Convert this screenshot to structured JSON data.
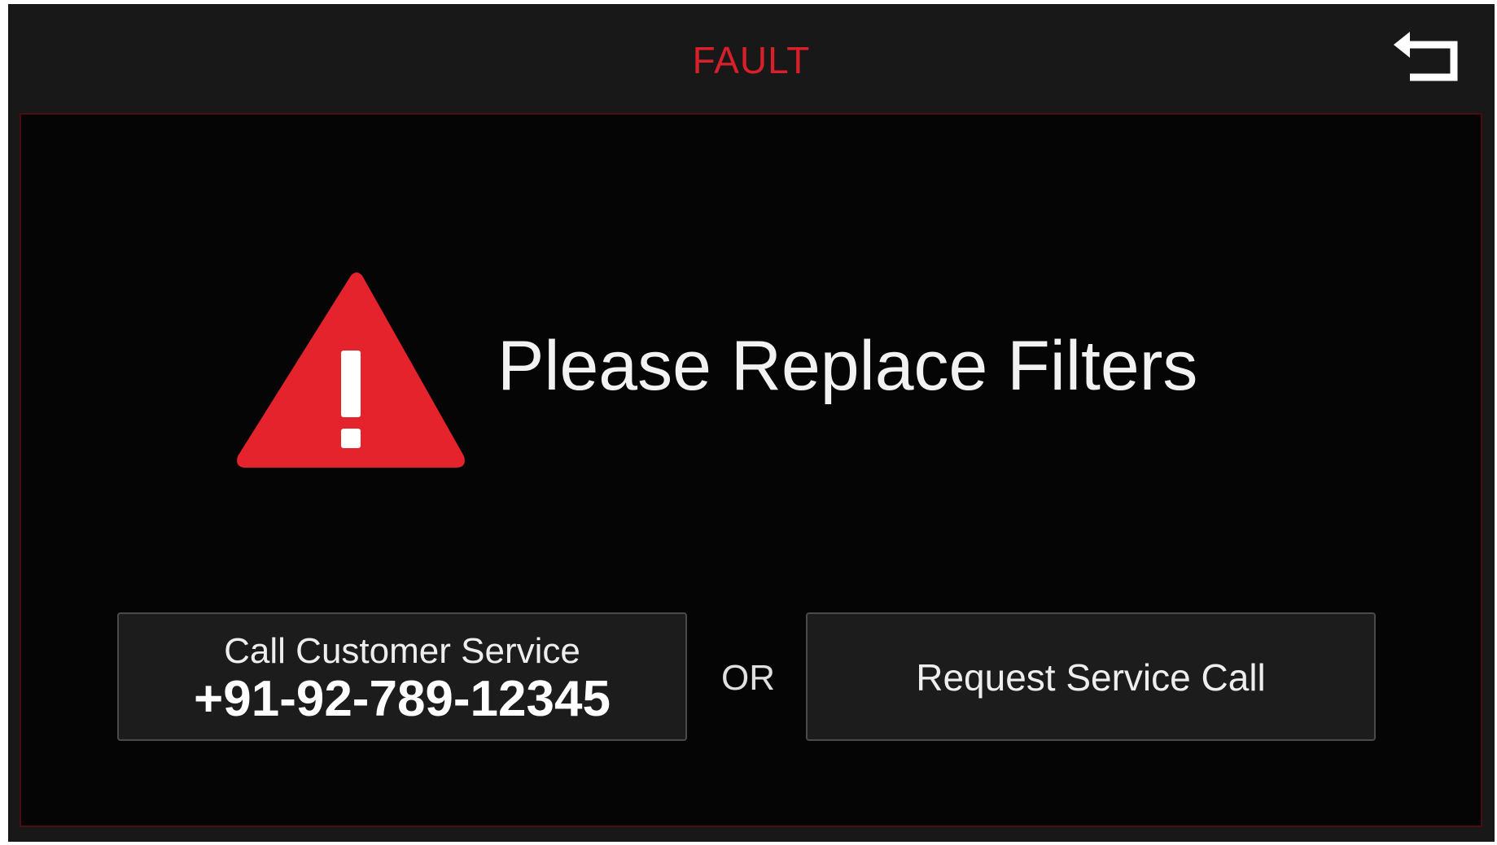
{
  "header": {
    "title": "FAULT",
    "title_color": "#d8202a",
    "back_icon": "back-return-icon"
  },
  "alert": {
    "icon": "warning-triangle-icon",
    "icon_color": "#e5232c",
    "message": "Please Replace Filters"
  },
  "actions": {
    "call_label": "Call Customer Service",
    "call_number": "+91-92-789-12345",
    "separator": "OR",
    "request_label": "Request Service Call"
  }
}
